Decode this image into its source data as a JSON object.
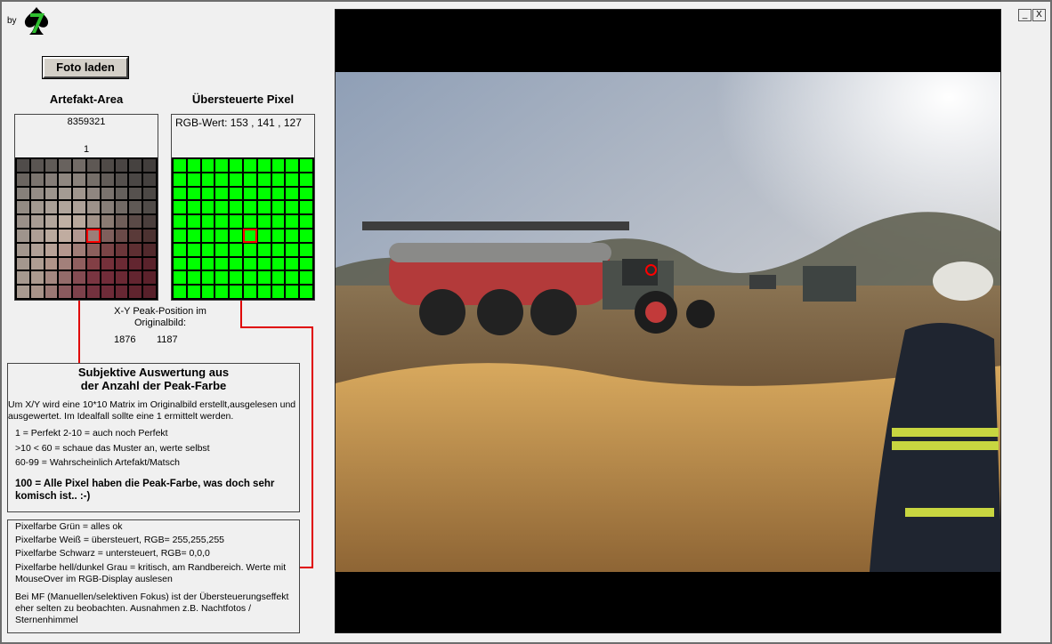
{
  "header": {
    "by_label": "by"
  },
  "buttons": {
    "load_photo": "Foto laden"
  },
  "artifact": {
    "title": "Artefakt-Area",
    "value": "8359321",
    "count": "1"
  },
  "overexposed": {
    "title": "Übersteuerte Pixel",
    "rgb_label": "RGB-Wert:",
    "rgb_values": "153  ,  141  ,  127"
  },
  "peak": {
    "label_line1": "X-Y Peak-Position  im",
    "label_line2": "Originalbild:",
    "x": "1876",
    "y": "1187"
  },
  "evaluation": {
    "title_line1": "Subjektive Auswertung aus",
    "title_line2": "der Anzahl der Peak-Farbe",
    "description": "Um X/Y wird eine 10*10 Matrix im Originalbild erstellt,ausgelesen und ausgewertet. Im Idealfall sollte eine 1 ermittelt werden.",
    "r1": "1 = Perfekt       2-10 = auch noch Perfekt",
    "r2": ">10 < 60  =  schaue das Muster an, werte selbst",
    "r3": "60-99 = Wahrscheinlich Artefakt/Matsch",
    "r4": "100 = Alle Pixel haben die Peak-Farbe, was doch sehr komisch ist..   :-)"
  },
  "legend": {
    "l1": "Pixelfarbe Grün = alles ok",
    "l2": "Pixelfarbe Weiß = übersteuert, RGB= 255,255,255",
    "l3": "Pixelfarbe Schwarz = untersteuert, RGB= 0,0,0",
    "l4": "Pixelfarbe hell/dunkel Grau = kritisch, am Randbereich. Werte mit MouseOver im RGB-Display auslesen",
    "l5": "Bei MF (Manuellen/selektiven Fokus) ist der Übersteuerungseffekt eher selten zu beobachten. Ausnahmen z.B. Nachtfotos / Sternenhimmel"
  },
  "window_controls": {
    "minimize": "_",
    "close": "X"
  },
  "icons": {
    "logo": "spade-7-logo-icon",
    "minimize": "minimize-icon",
    "close": "close-icon"
  },
  "colors": {
    "ok_green": "#00ff00",
    "marker_red": "#ff0000",
    "connector_red": "#e00000"
  },
  "artifact_matrix": [
    [
      "#504c4a",
      "#5a5552",
      "#605b57",
      "#68625e",
      "#726b66",
      "#5e5854",
      "#4f4a47",
      "#4a4543",
      "#464240",
      "#423e3c"
    ],
    [
      "#6b6560",
      "#7b746e",
      "#857d77",
      "#8f8780",
      "#8a827b",
      "#766f69",
      "#625c58",
      "#55504d",
      "#4b4745",
      "#45413f"
    ],
    [
      "#86807a",
      "#958d86",
      "#9d958d",
      "#a49b93",
      "#a0968e",
      "#8f8680",
      "#7a736e",
      "#65605c",
      "#56514e",
      "#4c4845"
    ],
    [
      "#938b84",
      "#a29990",
      "#aaa097",
      "#b0a59c",
      "#ada198",
      "#9d928a",
      "#877e78",
      "#726a65",
      "#5f5955",
      "#504b48"
    ],
    [
      "#9a9089",
      "#a89d94",
      "#b2a69c",
      "#bfb0a4",
      "#b8a89c",
      "#a29288",
      "#8a7a72",
      "#6f5e59",
      "#5a4a47",
      "#4a3e3c"
    ],
    [
      "#9f948c",
      "#ae9f95",
      "#b9a99d",
      "#c0aca0",
      "#b29891",
      "#9b7e78",
      "#7f5f5c",
      "#6a4a48",
      "#5a3a39",
      "#4c3231"
    ],
    [
      "#a2968d",
      "#b0a096",
      "#b8a297",
      "#b4978e",
      "#a07d77",
      "#8b5f5c",
      "#7a4446",
      "#6b3639",
      "#5e2f32",
      "#52292c"
    ],
    [
      "#a4978e",
      "#b09e93",
      "#b09489",
      "#a2807a",
      "#905f5f",
      "#823f45",
      "#75303a",
      "#6c2a34",
      "#632630",
      "#5a222b"
    ],
    [
      "#a6998f",
      "#ac9a8f",
      "#a48780",
      "#936b6a",
      "#844b52",
      "#7a3541",
      "#722c39",
      "#6b2934",
      "#632530",
      "#5b212b"
    ],
    [
      "#a89a90",
      "#a89389",
      "#9a7874",
      "#8a5a5e",
      "#7d414b",
      "#74313e",
      "#6e2b38",
      "#672733",
      "#60242e",
      "#58202a"
    ]
  ]
}
